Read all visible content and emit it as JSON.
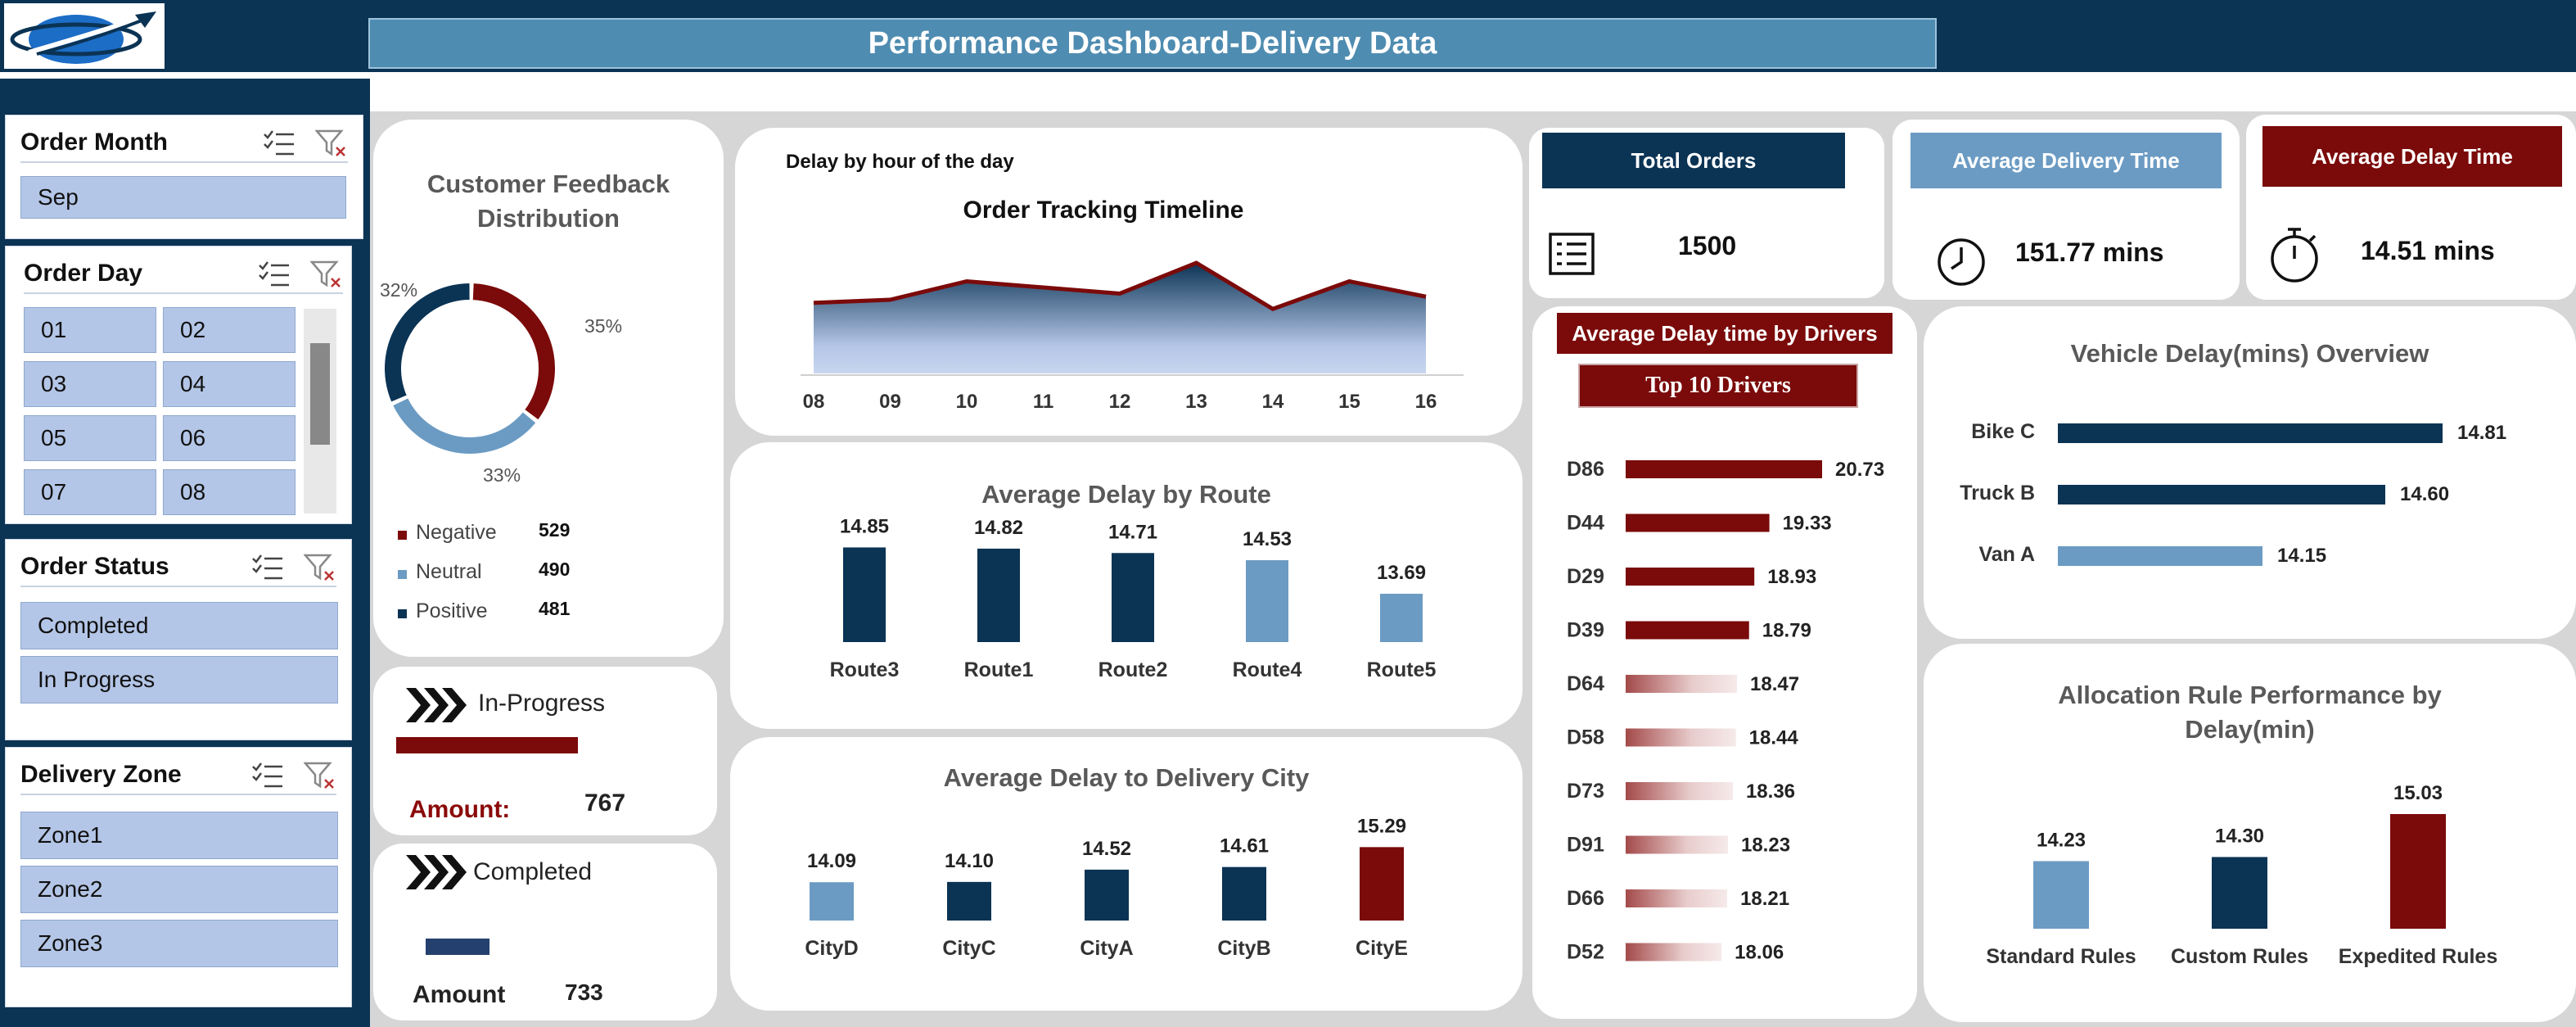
{
  "header": {
    "title": "Performance Dashboard-Delivery Data"
  },
  "colors": {
    "navy": "#0b3354",
    "maroon": "#7b0a0a",
    "steel": "#6b9bc3",
    "slicer": "#b4c6e7",
    "light_blue": "#4f8cb1"
  },
  "slicers": {
    "order_month": {
      "title": "Order Month",
      "items": [
        "Sep"
      ]
    },
    "order_day": {
      "title": "Order Day",
      "items": [
        "01",
        "02",
        "03",
        "04",
        "05",
        "06",
        "07",
        "08"
      ]
    },
    "order_status": {
      "title": "Order Status",
      "items": [
        "Completed",
        "In Progress"
      ]
    },
    "delivery_zone": {
      "title": "Delivery Zone",
      "items": [
        "Zone1",
        "Zone2",
        "Zone3"
      ]
    }
  },
  "feedback": {
    "title_line1": "Customer Feedback",
    "title_line2": "Distribution",
    "slices": [
      {
        "label": "Negative",
        "count": 529,
        "pct": "35%",
        "color": "#7b0a0a"
      },
      {
        "label": "Neutral",
        "count": 490,
        "pct": "33%",
        "color": "#6b9bc3"
      },
      {
        "label": "Positive",
        "count": 481,
        "pct": "32%",
        "color": "#0b3354"
      }
    ]
  },
  "status_cards": {
    "in_progress": {
      "label": "In-Progress",
      "amount_label": "Amount:",
      "amount": "767"
    },
    "completed": {
      "label": "Completed",
      "amount_label": "Amount",
      "amount": "733"
    }
  },
  "kpis": {
    "total_orders": {
      "label": "Total Orders",
      "value": "1500"
    },
    "avg_delivery": {
      "label": "Average Delivery Time",
      "value": "151.77 mins"
    },
    "avg_delay": {
      "label": "Average Delay Time",
      "value": "14.51 mins"
    }
  },
  "chart_data": [
    {
      "id": "timeline",
      "type": "area",
      "title": "Order Tracking Timeline",
      "subtitle": "Delay by hour of the day",
      "categories": [
        "08",
        "09",
        "10",
        "11",
        "12",
        "13",
        "14",
        "15",
        "16"
      ],
      "values": [
        14.3,
        14.4,
        15.0,
        14.8,
        14.6,
        15.6,
        14.1,
        15.0,
        14.5
      ],
      "ylim": [
        12,
        16
      ]
    },
    {
      "id": "route",
      "type": "bar",
      "title": "Average Delay by Route",
      "categories": [
        "Route3",
        "Route1",
        "Route2",
        "Route4",
        "Route5"
      ],
      "values": [
        14.85,
        14.82,
        14.71,
        14.53,
        13.69
      ],
      "labels": [
        "14.85",
        "14.82",
        "14.71",
        "14.53",
        "13.69"
      ],
      "colors": [
        "#0b3354",
        "#0b3354",
        "#0b3354",
        "#6b9bc3",
        "#6b9bc3"
      ],
      "ylim": [
        13.3,
        14.9
      ]
    },
    {
      "id": "city",
      "type": "bar",
      "title": "Average Delay to Delivery City",
      "categories": [
        "CityD",
        "CityC",
        "CityA",
        "CityB",
        "CityE"
      ],
      "values": [
        14.09,
        14.1,
        14.52,
        14.61,
        15.29
      ],
      "labels": [
        "14.09",
        "14.10",
        "14.52",
        "14.61",
        "15.29"
      ],
      "colors": [
        "#6b9bc3",
        "#0b3354",
        "#0b3354",
        "#0b3354",
        "#7b0a0a"
      ],
      "ylim": [
        13.9,
        15.3
      ]
    },
    {
      "id": "drivers",
      "type": "bar",
      "title": "Average Delay time by Drivers",
      "subtitle": "Top 10 Drivers",
      "categories": [
        "D86",
        "D44",
        "D29",
        "D39",
        "D64",
        "D58",
        "D73",
        "D91",
        "D66",
        "D52"
      ],
      "values": [
        20.73,
        19.33,
        18.93,
        18.79,
        18.47,
        18.44,
        18.36,
        18.23,
        18.21,
        18.06
      ],
      "labels": [
        "20.73",
        "19.33",
        "18.93",
        "18.79",
        "18.47",
        "18.44",
        "18.36",
        "18.23",
        "18.21",
        "18.06"
      ],
      "highlight_top": 4
    },
    {
      "id": "vehicle",
      "type": "bar",
      "title": "Vehicle Delay(mins) Overview",
      "categories": [
        "Bike C",
        "Truck B",
        "Van A"
      ],
      "values": [
        14.81,
        14.6,
        14.15
      ],
      "labels": [
        "14.81",
        "14.60",
        "14.15"
      ],
      "colors": [
        "#0b3354",
        "#0b3354",
        "#6b9bc3"
      ],
      "xlim": [
        13.4,
        14.81
      ]
    },
    {
      "id": "allocation",
      "type": "bar",
      "title_line1": "Allocation Rule Performance by",
      "title_line2": "Delay(min)",
      "categories": [
        "Standard Rules",
        "Custom Rules",
        "Expedited Rules"
      ],
      "values": [
        14.23,
        14.3,
        15.03
      ],
      "labels": [
        "14.23",
        "14.30",
        "15.03"
      ],
      "colors": [
        "#6b9bc3",
        "#0b3354",
        "#7b0a0a"
      ],
      "ylim": [
        14.0,
        15.03
      ]
    }
  ]
}
